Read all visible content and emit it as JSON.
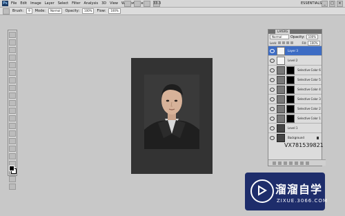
{
  "menubar": {
    "app_logo": "Ps",
    "items": [
      "File",
      "Edit",
      "Image",
      "Layer",
      "Select",
      "Filter",
      "Analysis",
      "3D",
      "View",
      "Window",
      "Help"
    ],
    "zoom": "33.3",
    "workspace": "ESSENTIALS"
  },
  "options": {
    "brush_label": "Brush:",
    "brush_size": "9",
    "mode_label": "Mode:",
    "mode_value": "Normal",
    "opacity_label": "Opacity:",
    "opacity_value": "100%",
    "flow_label": "Flow:",
    "flow_value": "100%"
  },
  "layers_panel": {
    "tab": "LAYERS",
    "blend_mode": "Normal",
    "opacity_label": "Opacity:",
    "opacity_value": "100%",
    "lock_label": "Lock:",
    "fill_label": "Fill:",
    "fill_value": "100%",
    "layers": [
      {
        "name": "Layer 3",
        "selected": true,
        "kind": "plain"
      },
      {
        "name": "Level 2",
        "selected": false,
        "kind": "plain"
      },
      {
        "name": "Selective Color 6",
        "selected": false,
        "kind": "adjustment"
      },
      {
        "name": "Selective Color 5",
        "selected": false,
        "kind": "adjustment"
      },
      {
        "name": "Selective Color 4",
        "selected": false,
        "kind": "adjustment"
      },
      {
        "name": "Selective Color 3",
        "selected": false,
        "kind": "adjustment"
      },
      {
        "name": "Selective Color 2",
        "selected": false,
        "kind": "adjustment"
      },
      {
        "name": "Selective Color 1",
        "selected": false,
        "kind": "adjustment"
      },
      {
        "name": "Level 1",
        "selected": false,
        "kind": "dark"
      },
      {
        "name": "Background",
        "selected": false,
        "kind": "dark"
      }
    ]
  },
  "overlay_id": "VX781539821",
  "watermark": {
    "title": "溜溜自学",
    "url": "ZIXUE.3066.COM"
  }
}
